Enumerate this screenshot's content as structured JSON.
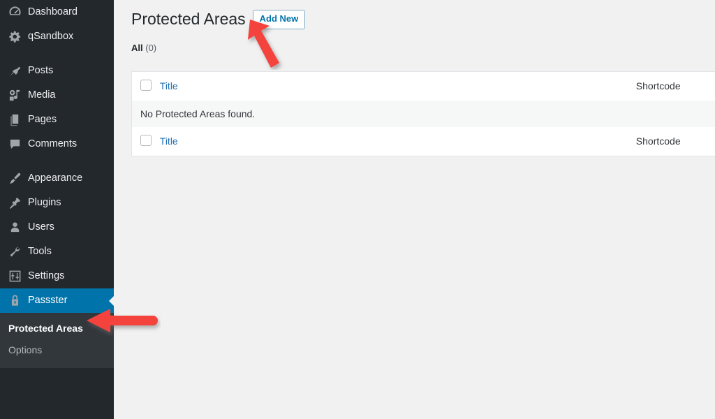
{
  "sidebar": {
    "items": [
      {
        "label": "Dashboard",
        "icon": "dashboard-icon"
      },
      {
        "label": "qSandbox",
        "icon": "gear-icon"
      },
      {
        "label": "Posts",
        "icon": "pin-icon"
      },
      {
        "label": "Media",
        "icon": "media-icon"
      },
      {
        "label": "Pages",
        "icon": "pages-icon"
      },
      {
        "label": "Comments",
        "icon": "comment-icon"
      },
      {
        "label": "Appearance",
        "icon": "paintbrush-icon"
      },
      {
        "label": "Plugins",
        "icon": "plug-icon"
      },
      {
        "label": "Users",
        "icon": "user-icon"
      },
      {
        "label": "Tools",
        "icon": "wrench-icon"
      },
      {
        "label": "Settings",
        "icon": "sliders-icon"
      },
      {
        "label": "Passster",
        "icon": "lock-icon"
      }
    ],
    "submenu": [
      {
        "label": "Protected Areas",
        "active": true
      },
      {
        "label": "Options",
        "active": false
      }
    ],
    "colors": {
      "background": "#23282d",
      "submenu_background": "#32373c",
      "active_background": "#0073aa",
      "text": "#eeeeee",
      "muted_text": "#b4b9be"
    }
  },
  "header": {
    "title": "Protected Areas",
    "add_new_label": "Add New"
  },
  "filters": {
    "label": "All",
    "count": "(0)"
  },
  "table": {
    "columns": {
      "title": "Title",
      "shortcode": "Shortcode"
    },
    "empty_message": "No Protected Areas found.",
    "rows": []
  },
  "annotations": {
    "arrow_color": "#f4433c",
    "arrows": [
      {
        "name": "arrow-pointing-to-add-new",
        "direction": "up-left"
      },
      {
        "name": "arrow-pointing-to-protected-areas",
        "direction": "left"
      }
    ]
  }
}
